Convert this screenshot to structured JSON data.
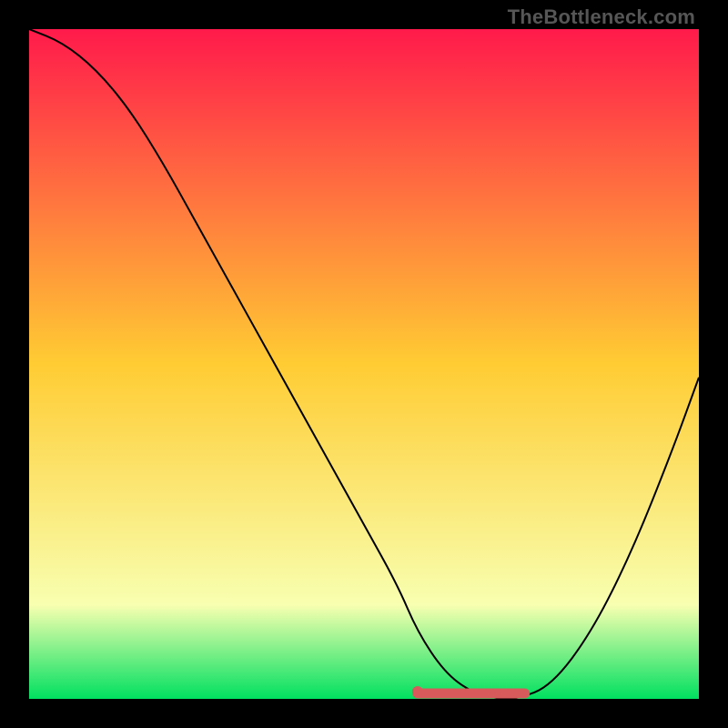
{
  "watermark": "TheBottleneck.com",
  "colors": {
    "frame": "#000000",
    "grad_top": "#ff1a4b",
    "grad_mid": "#ffcc33",
    "grad_low": "#f8ffb0",
    "grad_bottom": "#00e060",
    "curve": "#000000",
    "marker": "#d85a5a"
  },
  "chart_data": {
    "type": "line",
    "title": "",
    "xlabel": "",
    "ylabel": "",
    "xlim": [
      0,
      100
    ],
    "ylim": [
      0,
      100
    ],
    "series": [
      {
        "name": "bottleneck-curve",
        "x": [
          0,
          5,
          10,
          15,
          20,
          25,
          30,
          35,
          40,
          45,
          50,
          55,
          58,
          62,
          66,
          70,
          73,
          78,
          84,
          90,
          96,
          100
        ],
        "y": [
          100,
          98,
          94,
          88,
          80,
          71,
          62,
          53,
          44,
          35,
          26,
          17,
          10,
          4,
          1,
          0,
          0,
          2,
          10,
          22,
          37,
          48
        ]
      }
    ],
    "annotations": [
      {
        "name": "optimal-band",
        "x_start": 58,
        "x_end": 74,
        "y": 0
      }
    ]
  }
}
